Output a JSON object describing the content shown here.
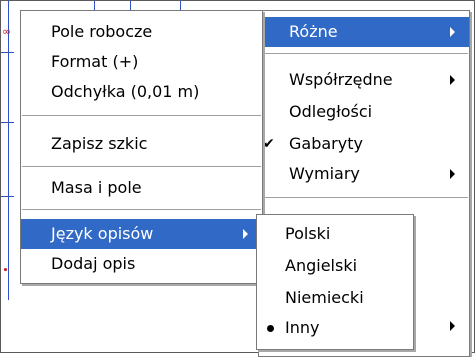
{
  "main_menu": {
    "items": [
      {
        "label": "Pole robocze"
      },
      {
        "label": "Format (+)"
      },
      {
        "label": "Odchyłka (0,01 m)"
      },
      {
        "label": "Zapisz szkic"
      },
      {
        "label": "Masa i pole"
      },
      {
        "label": "Język opisów",
        "selected": true
      },
      {
        "label": "Dodaj opis"
      }
    ]
  },
  "parent_menu": {
    "items": [
      {
        "label": "Różne",
        "selected": true
      },
      {
        "label": "Współrzędne"
      },
      {
        "label": "Odległości"
      },
      {
        "label": "Gabaryty",
        "checked": true
      },
      {
        "label": "Wymiary"
      }
    ]
  },
  "language_submenu": {
    "items": [
      {
        "label": "Polski"
      },
      {
        "label": "Angielski"
      },
      {
        "label": "Niemiecki"
      },
      {
        "label": "Inny",
        "checked": true
      }
    ]
  },
  "colors": {
    "selection": "#3169c6",
    "drawing_lines": "#3050c8",
    "marks": "#d02020"
  }
}
